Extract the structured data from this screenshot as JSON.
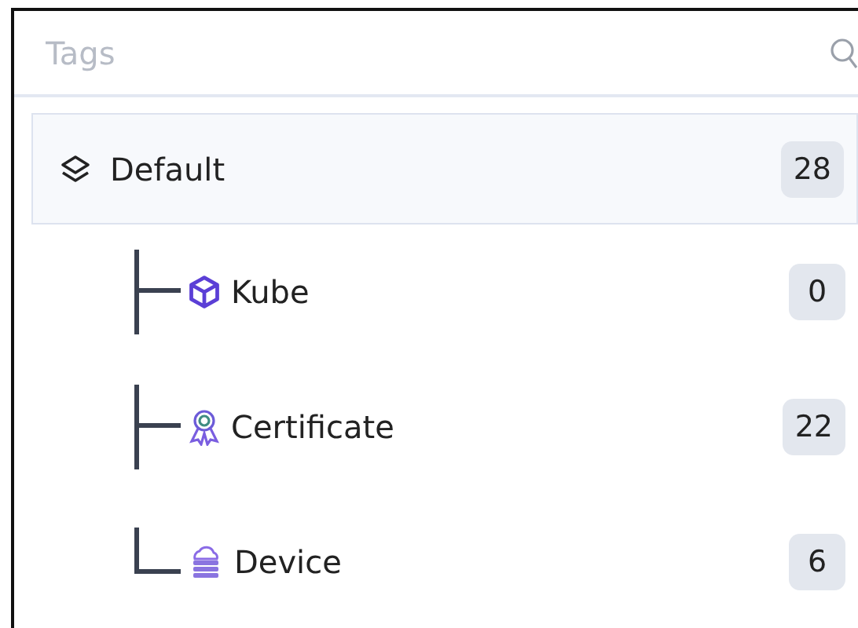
{
  "search": {
    "placeholder": "Tags"
  },
  "tree": [
    {
      "label": "Default",
      "count": "28",
      "selected": true,
      "children": [
        {
          "label": "Kube",
          "count": "0",
          "selected": false
        },
        {
          "label": "Certificate",
          "count": "22",
          "selected": false
        },
        {
          "label": "Device",
          "count": "6",
          "selected": false
        }
      ]
    }
  ]
}
